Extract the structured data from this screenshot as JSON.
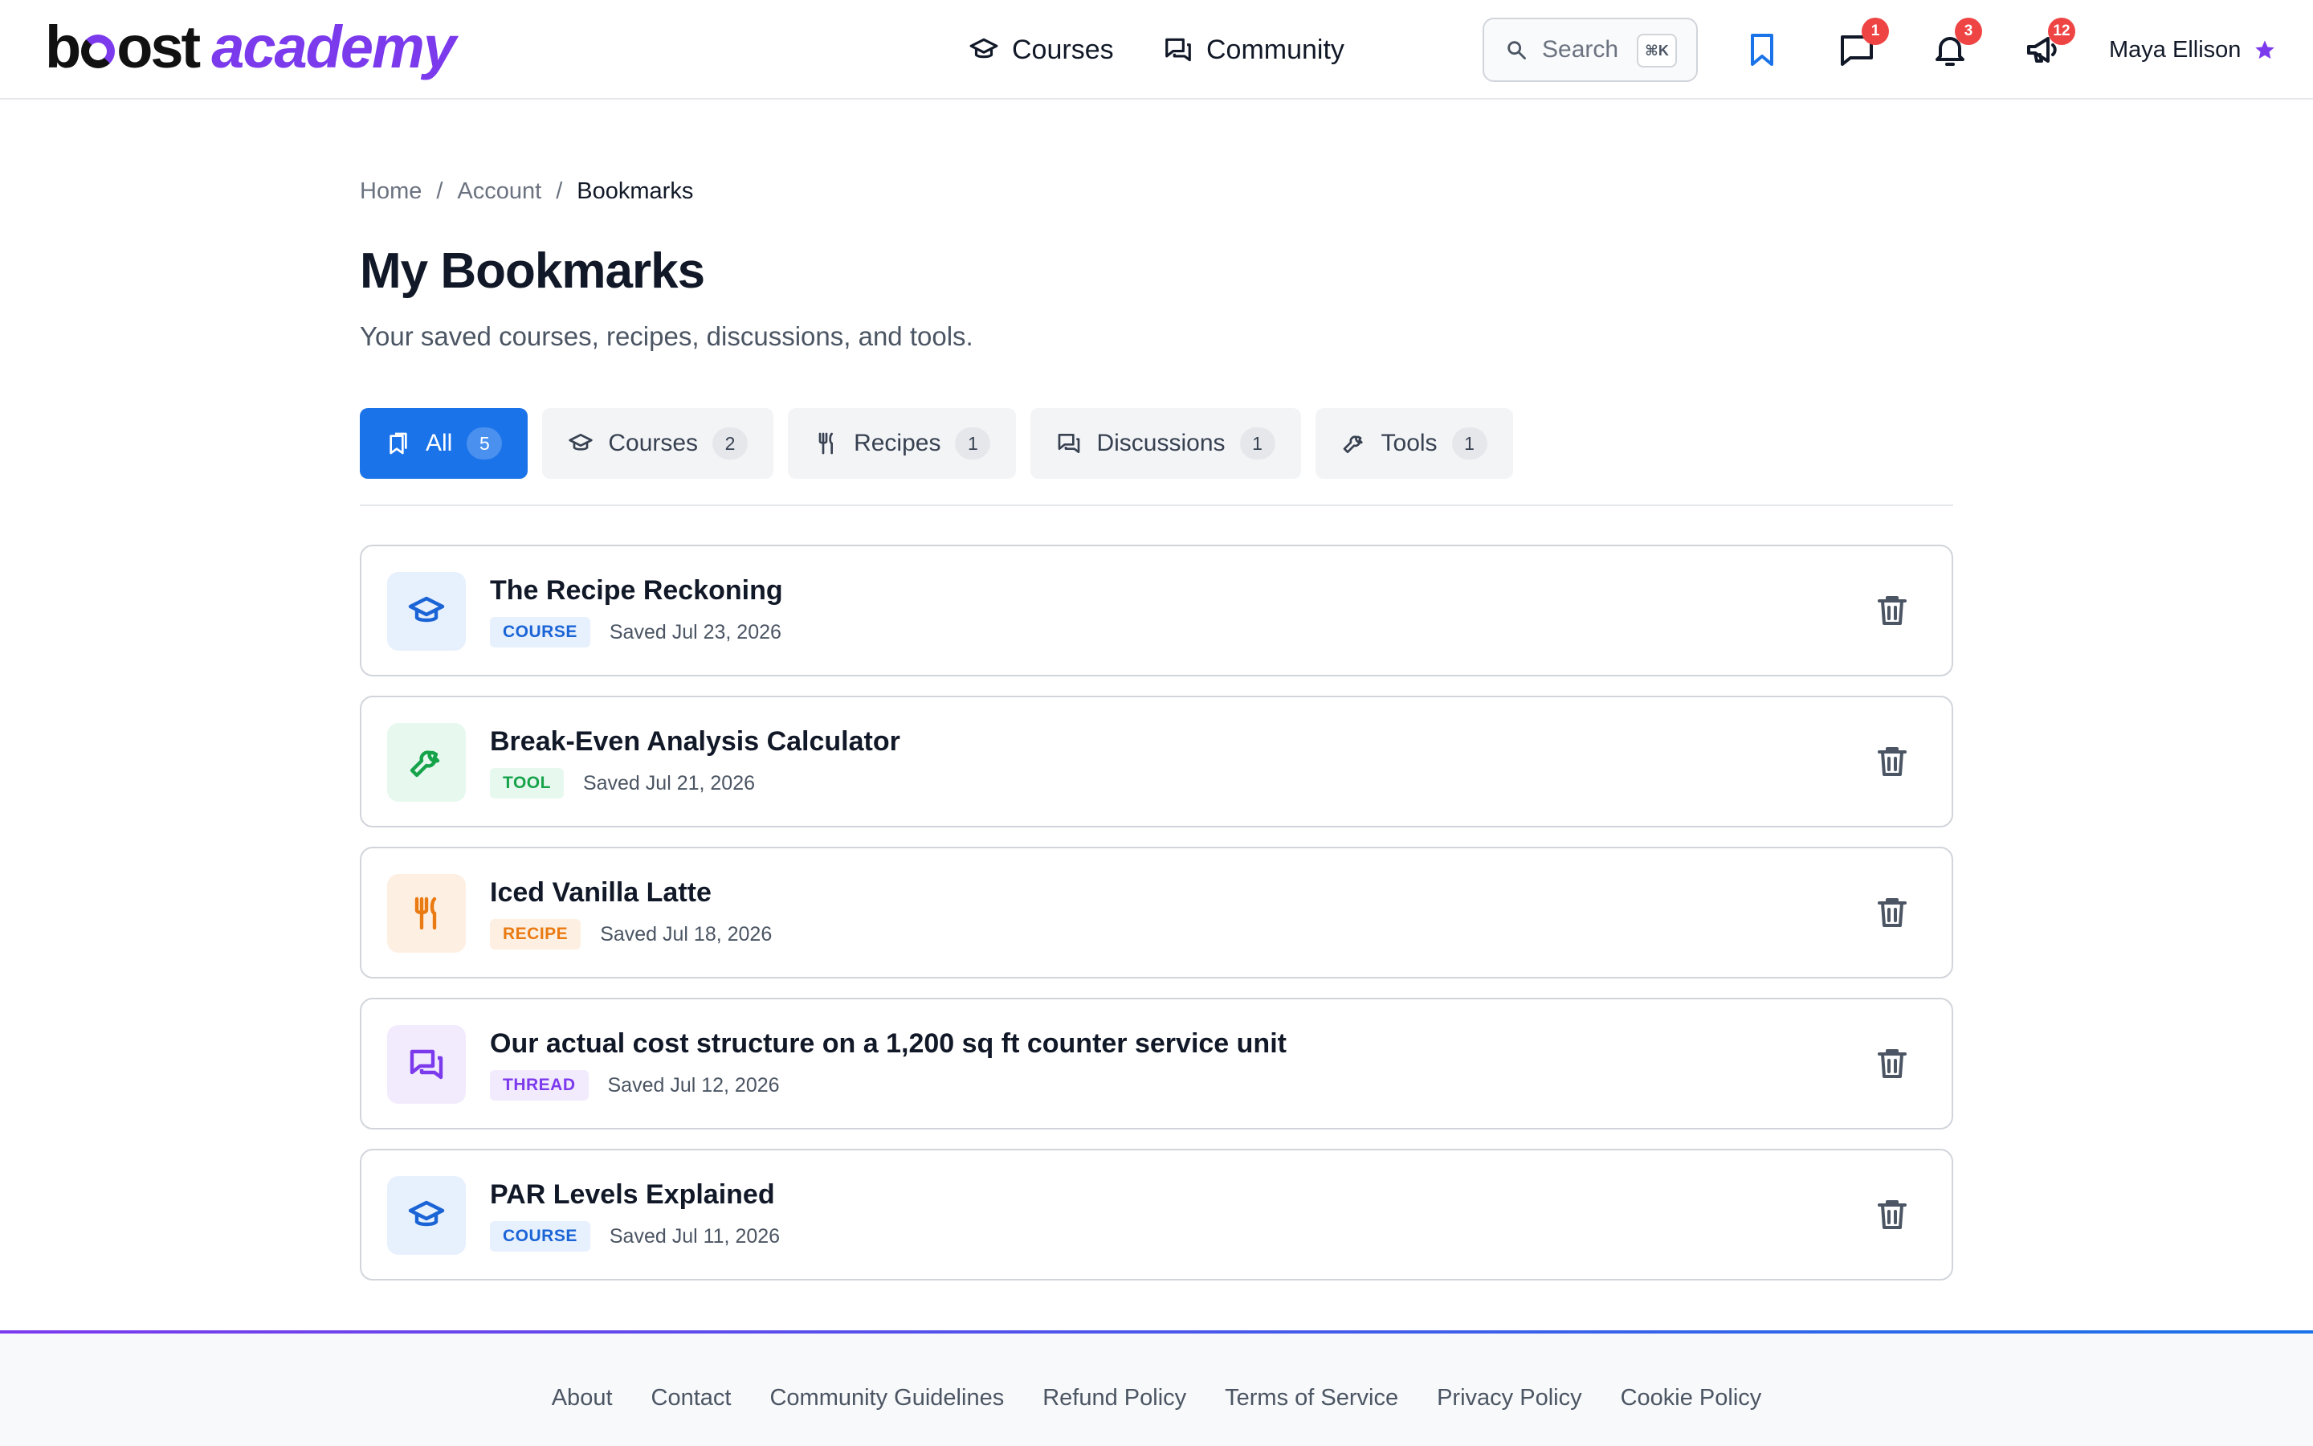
{
  "brand": {
    "part1": "b",
    "part2": "ost",
    "part3": "academy"
  },
  "nav": {
    "courses": {
      "label": "Courses",
      "icon": "graduation-cap-icon"
    },
    "community": {
      "label": "Community",
      "icon": "chat-bubbles-icon"
    }
  },
  "search": {
    "placeholder": "Search",
    "shortcut": "⌘K"
  },
  "header_icons": {
    "messages_badge": "1",
    "notifications_badge": "3",
    "announcements_badge": "12"
  },
  "user": {
    "name": "Maya Ellison"
  },
  "breadcrumb": {
    "home": "Home",
    "sep": "/",
    "account": "Account",
    "current": "Bookmarks"
  },
  "page": {
    "title": "My Bookmarks",
    "subtitle": "Your saved courses, recipes, discussions, and tools."
  },
  "tabs": [
    {
      "label": "All",
      "count": "5",
      "active": true
    },
    {
      "label": "Courses",
      "count": "2",
      "active": false
    },
    {
      "label": "Recipes",
      "count": "1",
      "active": false
    },
    {
      "label": "Discussions",
      "count": "1",
      "active": false
    },
    {
      "label": "Tools",
      "count": "1",
      "active": false
    }
  ],
  "bookmarks": [
    {
      "title": "The Recipe Reckoning",
      "type": "COURSE",
      "saved": "Saved Jul 23, 2026"
    },
    {
      "title": "Break-Even Analysis Calculator",
      "type": "TOOL",
      "saved": "Saved Jul 21, 2026"
    },
    {
      "title": "Iced Vanilla Latte",
      "type": "RECIPE",
      "saved": "Saved Jul 18, 2026"
    },
    {
      "title": "Our actual cost structure on a 1,200 sq ft counter service unit",
      "type": "THREAD",
      "saved": "Saved Jul 12, 2026"
    },
    {
      "title": "PAR Levels Explained",
      "type": "COURSE",
      "saved": "Saved Jul 11, 2026"
    }
  ],
  "footer": {
    "links": [
      "About",
      "Contact",
      "Community Guidelines",
      "Refund Policy",
      "Terms of Service",
      "Privacy Policy",
      "Cookie Policy"
    ]
  },
  "colors": {
    "brand_purple": "#7c3aed",
    "accent_blue": "#1a73e8",
    "badge_red": "#ef4444",
    "course": "#1a64d6",
    "tool": "#16a34a",
    "recipe": "#ea7a12",
    "thread": "#7c3aed"
  }
}
